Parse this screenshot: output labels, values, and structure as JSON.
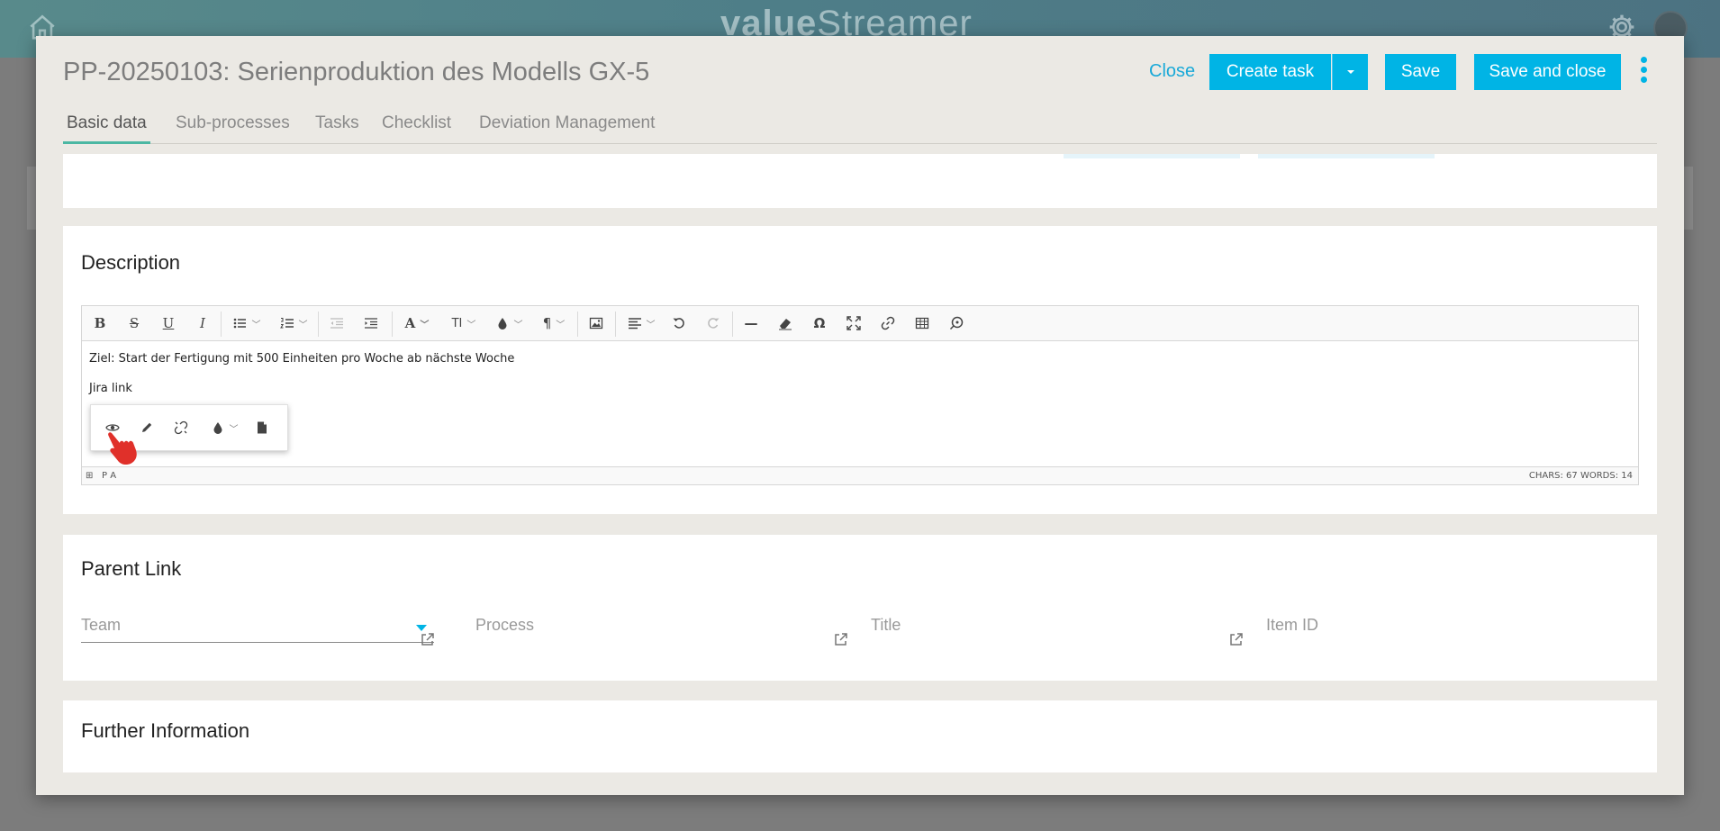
{
  "app": {
    "logo_part1": "value",
    "logo_part2": "Streamer"
  },
  "modal": {
    "title": "PP-20250103: Serienproduktion des Modells GX-5",
    "close_label": "Close",
    "create_task_label": "Create task",
    "save_label": "Save",
    "save_close_label": "Save and close"
  },
  "tabs": [
    {
      "label": "Basic data",
      "active": true
    },
    {
      "label": "Sub-processes",
      "active": false
    },
    {
      "label": "Tasks",
      "active": false
    },
    {
      "label": "Checklist",
      "active": false
    },
    {
      "label": "Deviation Management",
      "active": false
    }
  ],
  "description": {
    "title": "Description",
    "lines": [
      "Ziel: Start der Fertigung mit 500 Einheiten pro Woche ab nächste Woche",
      "Jira link"
    ],
    "status_left": "P  A",
    "status_right": "CHARS: 67   WORDS: 14",
    "toolbar": {
      "bold": "B",
      "strike": "S",
      "underline": "U",
      "italic": "I",
      "font": "A",
      "size": "TI",
      "paragraph": "¶",
      "hr": "—",
      "omega": "Ω"
    }
  },
  "parent_link": {
    "title": "Parent Link",
    "team_label": "Team",
    "process_label": "Process",
    "title_label": "Title",
    "item_id_label": "Item ID"
  },
  "further": {
    "title": "Further Information"
  },
  "colors": {
    "accent": "#00b4e5",
    "tab_active_underline": "#4bb7a3",
    "pointer_hand": "#e0302a"
  }
}
